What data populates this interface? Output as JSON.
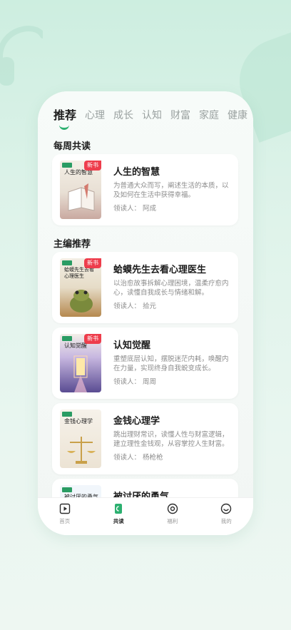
{
  "tabs": [
    "推荐",
    "心理",
    "成长",
    "认知",
    "财富",
    "家庭",
    "健康"
  ],
  "weekly": {
    "section_title": "每周共读",
    "book": {
      "title": "人生的智慧",
      "cover_title": "人生的智慧",
      "badge": "新书",
      "desc": "为普通大众而写，阐述生活的本质，以及如何在生活中获得幸福。",
      "reader": "领读人：  阿成"
    }
  },
  "editor": {
    "section_title": "主编推荐",
    "books": [
      {
        "title": "蛤蟆先生去看心理医生",
        "cover_title": "蛤蟆先生去看心理医生",
        "badge": "新书",
        "desc": "以治愈故事拆解心理困境，温柔疗愈内心，读懂自我成长与情绪和解。",
        "reader": "领读人：  拾元"
      },
      {
        "title": "认知觉醒",
        "cover_title": "认知觉醒",
        "badge": "新书",
        "desc": "重塑底层认知，摆脱迷茫内耗，唤醒内在力量，实现终身自我蜕变成长。",
        "reader": "领读人：  周周"
      },
      {
        "title": "金钱心理学",
        "cover_title": "金钱心理学",
        "badge": "",
        "desc": "跳出理财常识，读懂人性与财富逻辑，建立理性金钱观，从容掌控人生财富。",
        "reader": "领读人：  杨枪枪"
      },
      {
        "title": "被讨厌的勇气",
        "cover_title": "被讨厌的勇气",
        "badge": "",
        "desc": "",
        "reader": ""
      }
    ]
  },
  "nav": [
    {
      "label": "首页",
      "icon": "video-icon"
    },
    {
      "label": "共读",
      "icon": "book-icon"
    },
    {
      "label": "福利",
      "icon": "target-icon"
    },
    {
      "label": "我的",
      "icon": "smile-icon"
    }
  ],
  "colors": {
    "accent": "#2cb070",
    "badge": "#ee3d4c"
  }
}
